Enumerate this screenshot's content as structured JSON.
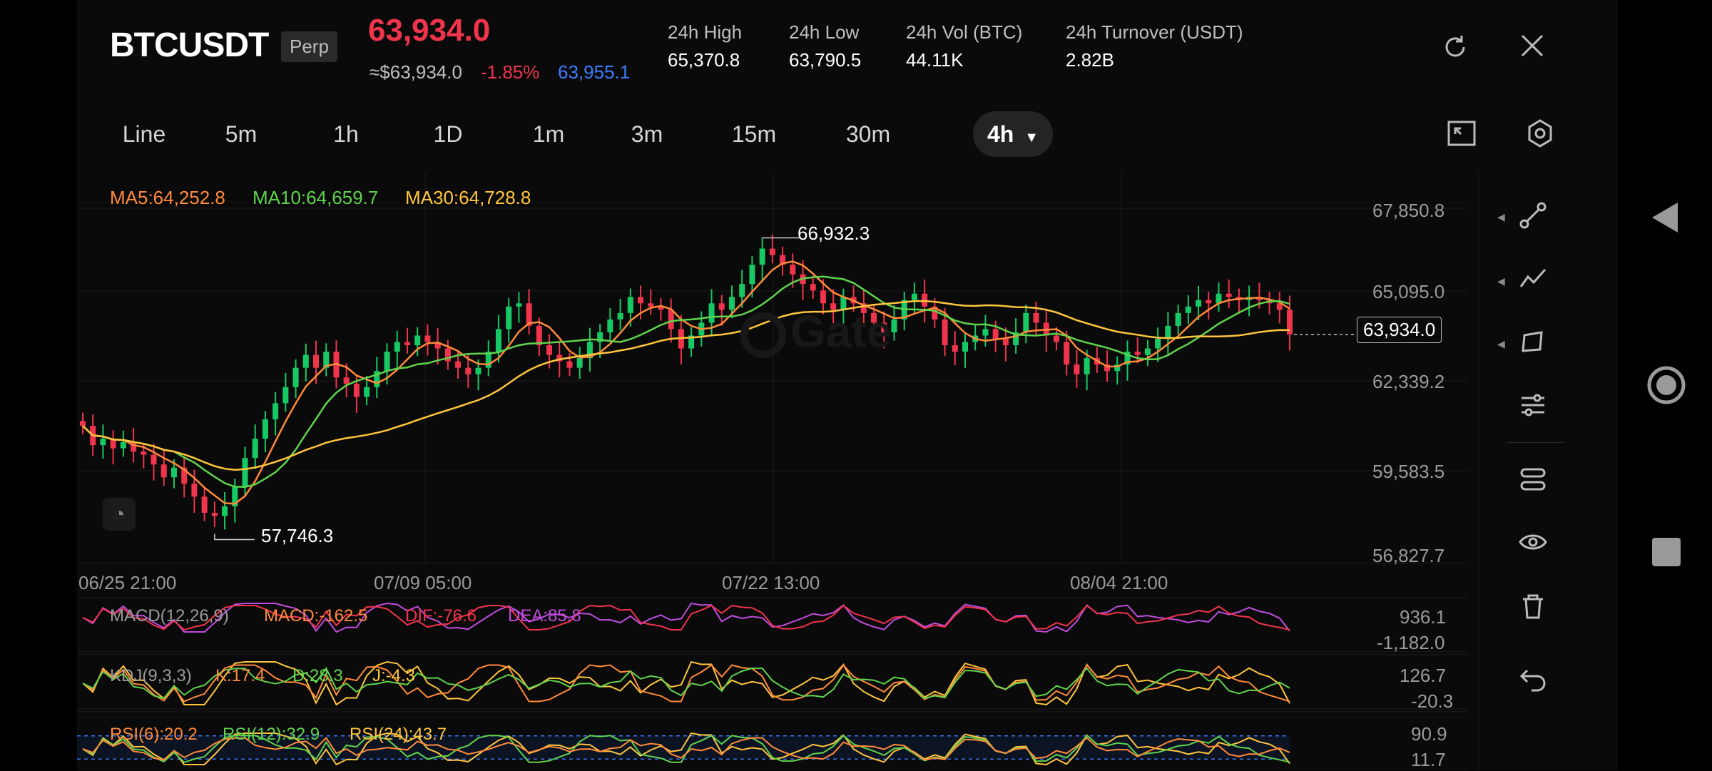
{
  "header": {
    "symbol": "BTCUSDT",
    "badge": "Perp",
    "price": "63,934.0",
    "usd_price": "≈$63,934.0",
    "change_pct": "-1.85%",
    "mark_price": "63,955.1",
    "stats": [
      {
        "label": "24h  High",
        "value": "65,370.8"
      },
      {
        "label": "24h  Low",
        "value": "63,790.5"
      },
      {
        "label": "24h  Vol (BTC)",
        "value": "44.11K"
      },
      {
        "label": "24h  Turnover (USDT)",
        "value": "2.82B"
      }
    ]
  },
  "timeframes": [
    "Line",
    "5m",
    "1h",
    "1D",
    "1m",
    "3m",
    "15m",
    "30m"
  ],
  "active_timeframe": "4h",
  "ma": {
    "ma5": "MA5:64,252.8",
    "ma10": "MA10:64,659.7",
    "ma30": "MA30:64,728.8"
  },
  "chart": {
    "y_labels": [
      "67,850.8",
      "65,095.0",
      "62,339.2",
      "59,583.5",
      "56,827.7"
    ],
    "x_labels": [
      "06/25 21:00",
      "07/09 05:00",
      "07/22 13:00",
      "08/04 21:00"
    ],
    "high_marker": "66,932.3",
    "low_marker": "57,746.3",
    "last_price_tag": "63,934.0",
    "watermark": "Gate"
  },
  "indicators": {
    "macd": {
      "name": "MACD(12,26,9)",
      "macd": "MACD:-162.5",
      "dif": "DIF:-76.6",
      "dea": "DEA:85.8",
      "top": "936.1",
      "bottom": "-1,182.0"
    },
    "kdj": {
      "name": "KDJ(9,3,3)",
      "k": "K:17.4",
      "d": "D:28.3",
      "j": "J:-4.3",
      "top": "126.7",
      "bottom": "-20.3"
    },
    "rsi": {
      "name": "RSI(6):20.2",
      "r12": "RSI(12):32.9",
      "r24": "RSI(24):43.7",
      "top": "90.9",
      "bottom": "11.7"
    }
  },
  "chart_data": {
    "type": "candlestick",
    "y_range": [
      56827.7,
      67850.8
    ],
    "closes": [
      61100,
      60500,
      60700,
      60400,
      60600,
      60300,
      60200,
      59900,
      59500,
      59800,
      59300,
      58900,
      58400,
      58300,
      58600,
      59200,
      60100,
      60700,
      61300,
      61800,
      62300,
      62900,
      63300,
      62900,
      63400,
      62600,
      62400,
      62000,
      62300,
      62800,
      63400,
      63700,
      63600,
      63900,
      63700,
      63500,
      63100,
      62900,
      62700,
      62900,
      63400,
      64100,
      64800,
      64900,
      64200,
      63600,
      63300,
      63100,
      62900,
      63200,
      63700,
      64000,
      64400,
      64600,
      65100,
      64900,
      64800,
      64700,
      64100,
      63500,
      63900,
      64300,
      64900,
      64700,
      65100,
      65500,
      66100,
      66600,
      66400,
      66100,
      65800,
      65500,
      65300,
      64900,
      64700,
      65100,
      64900,
      64600,
      64300,
      64000,
      64400,
      65000,
      65200,
      64800,
      64400,
      63600,
      63400,
      63700,
      63900,
      64100,
      63800,
      63600,
      64000,
      64600,
      64300,
      63900,
      63700,
      63000,
      62700,
      63200,
      63000,
      62800,
      63000,
      63400,
      63300,
      63500,
      63800,
      64200,
      64600,
      64800,
      65000,
      64900,
      65200,
      65100,
      65000,
      65100,
      65000,
      64900,
      64700,
      63934
    ],
    "ma5_value": 64252.8,
    "ma10_value": 64659.7,
    "ma30_value": 64728.8,
    "high": 66932.3,
    "low": 57746.3,
    "last": 63934.0
  },
  "sidebar_icons": [
    "drawing-line-icon",
    "trend-line-icon",
    "shape-tool-icon",
    "settings-sliders-icon",
    "indicator-icon",
    "visibility-icon",
    "delete-icon",
    "undo-icon"
  ],
  "colors": {
    "up": "#17c964",
    "down": "#f0344c",
    "ma5": "#ff8a3c",
    "ma10": "#5fd34d",
    "ma30": "#ffc53d",
    "accent": "#3d7dff"
  }
}
